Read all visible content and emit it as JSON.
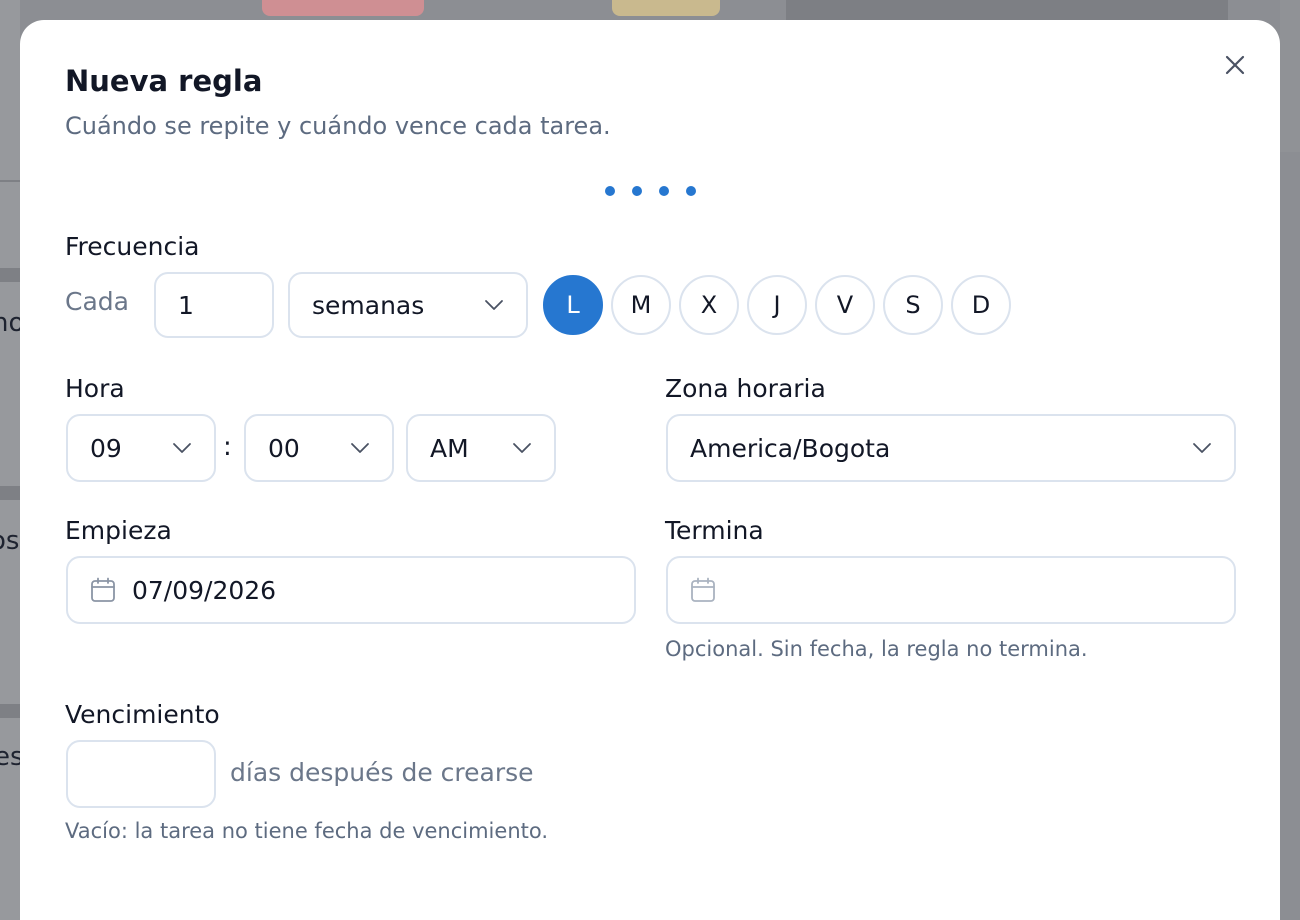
{
  "background": {
    "fragments": [
      "no",
      "os",
      "es"
    ],
    "badge_colors": [
      "#e9a9ad",
      "#e7d3a6"
    ]
  },
  "modal": {
    "title": "Nueva regla",
    "subtitle": "Cuándo se repite y cuándo vence cada tarea.",
    "close_icon": "close-icon",
    "steps": {
      "count": 4,
      "color": "#2677d0"
    }
  },
  "frecuencia": {
    "label": "Frecuencia",
    "cada_label": "Cada",
    "interval_value": "1",
    "unit_value": "semanas",
    "days": [
      {
        "label": "L",
        "selected": true
      },
      {
        "label": "M",
        "selected": false
      },
      {
        "label": "X",
        "selected": false
      },
      {
        "label": "J",
        "selected": false
      },
      {
        "label": "V",
        "selected": false
      },
      {
        "label": "S",
        "selected": false
      },
      {
        "label": "D",
        "selected": false
      }
    ]
  },
  "hora": {
    "label": "Hora",
    "hour": "09",
    "separator": ":",
    "minute": "00",
    "period": "AM"
  },
  "zona": {
    "label": "Zona horaria",
    "value": "America/Bogota"
  },
  "empieza": {
    "label": "Empieza",
    "value": "07/09/2026",
    "icon": "calendar-icon"
  },
  "termina": {
    "label": "Termina",
    "value": "",
    "icon": "calendar-icon",
    "help": "Opcional. Sin fecha, la regla no termina."
  },
  "vencimiento": {
    "label": "Vencimiento",
    "value": "",
    "suffix": "días después de crearse",
    "help": "Vacío: la tarea no tiene fecha de vencimiento."
  },
  "colors": {
    "accent": "#2677d0",
    "text": "#121726",
    "muted": "#5d6b80",
    "border": "#dbe3ee"
  }
}
